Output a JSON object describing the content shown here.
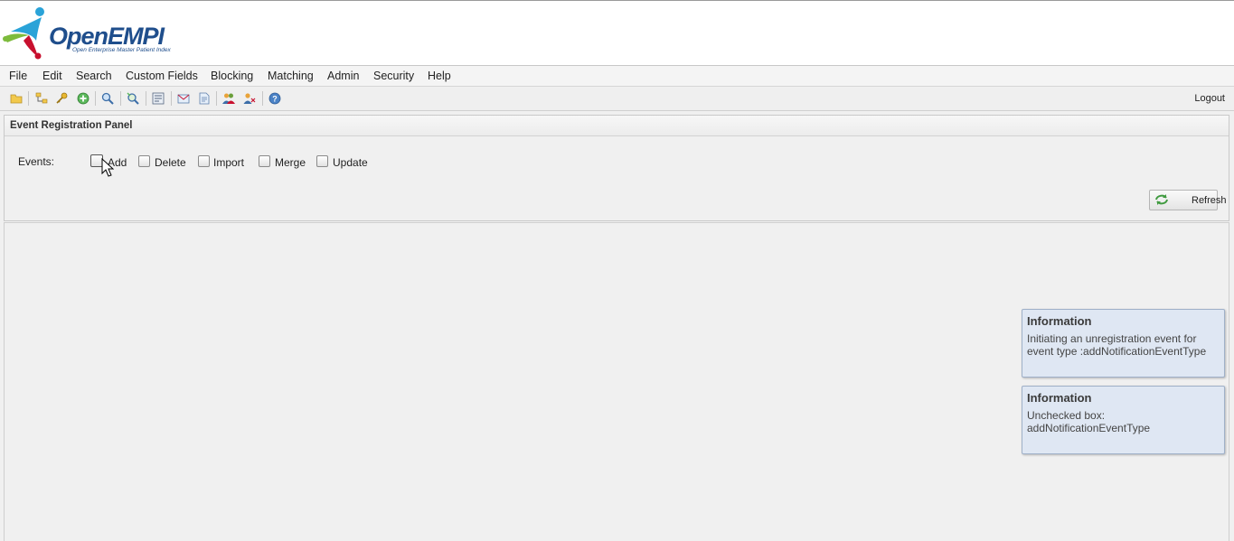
{
  "app": {
    "logo_text": "OpenEMPI",
    "logo_subtitle": "Open Enterprise Master Patient Index"
  },
  "menu": {
    "items": [
      {
        "label": "File"
      },
      {
        "label": "Edit"
      },
      {
        "label": "Search"
      },
      {
        "label": "Custom Fields"
      },
      {
        "label": "Blocking"
      },
      {
        "label": "Matching"
      },
      {
        "label": "Admin"
      },
      {
        "label": "Security"
      },
      {
        "label": "Help"
      }
    ]
  },
  "toolbar": {
    "icons": [
      "open-folder-icon",
      "tree-icon",
      "key-icon",
      "add-circle-icon",
      "search-icon",
      "advanced-search-icon",
      "report-icon",
      "envelope-icon",
      "document-icon",
      "users-icon",
      "user-link-icon",
      "help-icon"
    ],
    "logout_label": "Logout"
  },
  "panel": {
    "title": "Event Registration Panel",
    "events_label": "Events:",
    "checkboxes": [
      {
        "label": "Add",
        "checked": false
      },
      {
        "label": "Delete",
        "checked": false
      },
      {
        "label": "Import",
        "checked": false
      },
      {
        "label": "Merge",
        "checked": false
      },
      {
        "label": "Update",
        "checked": false
      }
    ],
    "refresh_label": "Refresh"
  },
  "notifications": [
    {
      "title": "Information",
      "body": "Initiating an unregistration event for event type :addNotificationEventType"
    },
    {
      "title": "Information",
      "body": "Unchecked box: addNotificationEventType"
    }
  ],
  "colors": {
    "logo_blue": "#1f4e8c",
    "logo_light_blue": "#2aa3d8",
    "notice_background": "#dfe7f3"
  }
}
